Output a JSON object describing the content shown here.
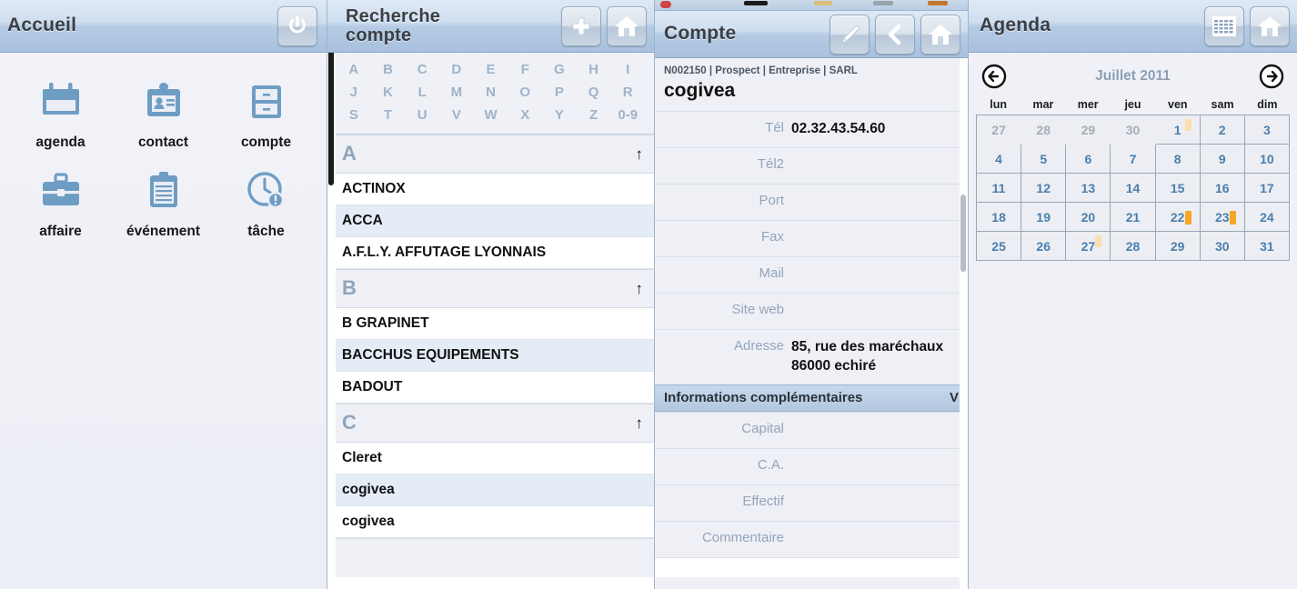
{
  "panels": {
    "home": {
      "title": "Accueil",
      "power_button": "power-button",
      "items": [
        {
          "label": "agenda",
          "icon": "calendar-icon"
        },
        {
          "label": "contact",
          "icon": "contact-card-icon"
        },
        {
          "label": "compte",
          "icon": "account-drawer-icon"
        },
        {
          "label": "affaire",
          "icon": "briefcase-icon"
        },
        {
          "label": "événement",
          "icon": "clipboard-icon"
        },
        {
          "label": "tâche",
          "icon": "clock-task-icon"
        }
      ]
    },
    "search": {
      "title_line1": "Recherche",
      "title_line2": "compte",
      "buttons": [
        {
          "name": "add-button",
          "icon": "plus-icon"
        },
        {
          "name": "home-button",
          "icon": "home-icon"
        }
      ],
      "alphabet": [
        [
          "A",
          "B",
          "C",
          "D",
          "E",
          "F",
          "G",
          "H",
          "I"
        ],
        [
          "J",
          "K",
          "L",
          "M",
          "N",
          "O",
          "P",
          "Q",
          "R"
        ],
        [
          "S",
          "T",
          "U",
          "V",
          "W",
          "X",
          "Y",
          "Z",
          "0-9"
        ]
      ],
      "groups": [
        {
          "letter": "A",
          "up_arrow": "↑",
          "rows": [
            "ACTINOX",
            "ACCA",
            "A.F.L.Y. AFFUTAGE LYONNAIS"
          ]
        },
        {
          "letter": "B",
          "up_arrow": "↑",
          "rows": [
            "B GRAPINET",
            "BACCHUS EQUIPEMENTS",
            "BADOUT"
          ]
        },
        {
          "letter": "C",
          "up_arrow": "↑",
          "rows": [
            "Cleret",
            "cogivea",
            "cogivea"
          ]
        }
      ]
    },
    "account": {
      "title": "Compte",
      "buttons": [
        {
          "name": "edit-button",
          "icon": "pen-icon"
        },
        {
          "name": "back-button",
          "icon": "chevron-left-icon"
        },
        {
          "name": "home-button",
          "icon": "home-icon"
        }
      ],
      "meta": "N002150 | Prospect | Entreprise | SARL",
      "name": "cogivea",
      "fields": [
        {
          "label": "Tél",
          "value": "02.32.43.54.60"
        },
        {
          "label": "Tél2",
          "value": ""
        },
        {
          "label": "Port",
          "value": ""
        },
        {
          "label": "Fax",
          "value": ""
        },
        {
          "label": "Mail",
          "value": ""
        },
        {
          "label": "Site web",
          "value": ""
        },
        {
          "label": "Adresse",
          "value": "85, rue des maréchaux\n86000 echiré"
        }
      ],
      "section": {
        "title": "Informations complémentaires",
        "chevron": "V"
      },
      "extra_fields": [
        {
          "label": "Capital",
          "value": ""
        },
        {
          "label": "C.A.",
          "value": ""
        },
        {
          "label": "Effectif",
          "value": ""
        },
        {
          "label": "Commentaire",
          "value": ""
        }
      ]
    },
    "agenda": {
      "title": "Agenda",
      "buttons": [
        {
          "name": "list-view-button",
          "icon": "grid-list-icon"
        },
        {
          "name": "home-button",
          "icon": "home-icon"
        }
      ],
      "prev_arrow": "prev-month-arrow",
      "next_arrow": "next-month-arrow",
      "month_label": "Juillet 2011",
      "day_headers": [
        "lun",
        "mar",
        "mer",
        "jeu",
        "ven",
        "sam",
        "dim"
      ],
      "weeks": [
        [
          {
            "d": "27",
            "out": true
          },
          {
            "d": "28",
            "out": true
          },
          {
            "d": "29",
            "out": true
          },
          {
            "d": "30",
            "out": true
          },
          {
            "d": "1",
            "out": false,
            "event": "light"
          },
          {
            "d": "2",
            "out": false
          },
          {
            "d": "3",
            "out": false
          }
        ],
        [
          {
            "d": "4",
            "out": false
          },
          {
            "d": "5",
            "out": false
          },
          {
            "d": "6",
            "out": false
          },
          {
            "d": "7",
            "out": false
          },
          {
            "d": "8",
            "out": false
          },
          {
            "d": "9",
            "out": false
          },
          {
            "d": "10",
            "out": false
          }
        ],
        [
          {
            "d": "11",
            "out": false
          },
          {
            "d": "12",
            "out": false
          },
          {
            "d": "13",
            "out": false
          },
          {
            "d": "14",
            "out": false
          },
          {
            "d": "15",
            "out": false
          },
          {
            "d": "16",
            "out": false
          },
          {
            "d": "17",
            "out": false
          }
        ],
        [
          {
            "d": "18",
            "out": false
          },
          {
            "d": "19",
            "out": false
          },
          {
            "d": "20",
            "out": false
          },
          {
            "d": "21",
            "out": false
          },
          {
            "d": "22",
            "out": false,
            "event": "strong"
          },
          {
            "d": "23",
            "out": false,
            "event": "strong"
          },
          {
            "d": "24",
            "out": false
          }
        ],
        [
          {
            "d": "25",
            "out": false
          },
          {
            "d": "26",
            "out": false
          },
          {
            "d": "27",
            "out": false,
            "event": "light"
          },
          {
            "d": "28",
            "out": false
          },
          {
            "d": "29",
            "out": false
          },
          {
            "d": "30",
            "out": false
          },
          {
            "d": "31",
            "out": false
          }
        ]
      ]
    }
  },
  "colors": {
    "header_gradient_top": "#dfe9f4",
    "header_gradient_bottom": "#a8c1de",
    "icon_blue": "#6e9dc4",
    "accent_orange": "#f5a623",
    "accent_orange_light": "#fbdfae",
    "day_number_blue": "#4a7fae",
    "label_grey": "#93a5ba",
    "section_blue": "#b2c8e0"
  }
}
